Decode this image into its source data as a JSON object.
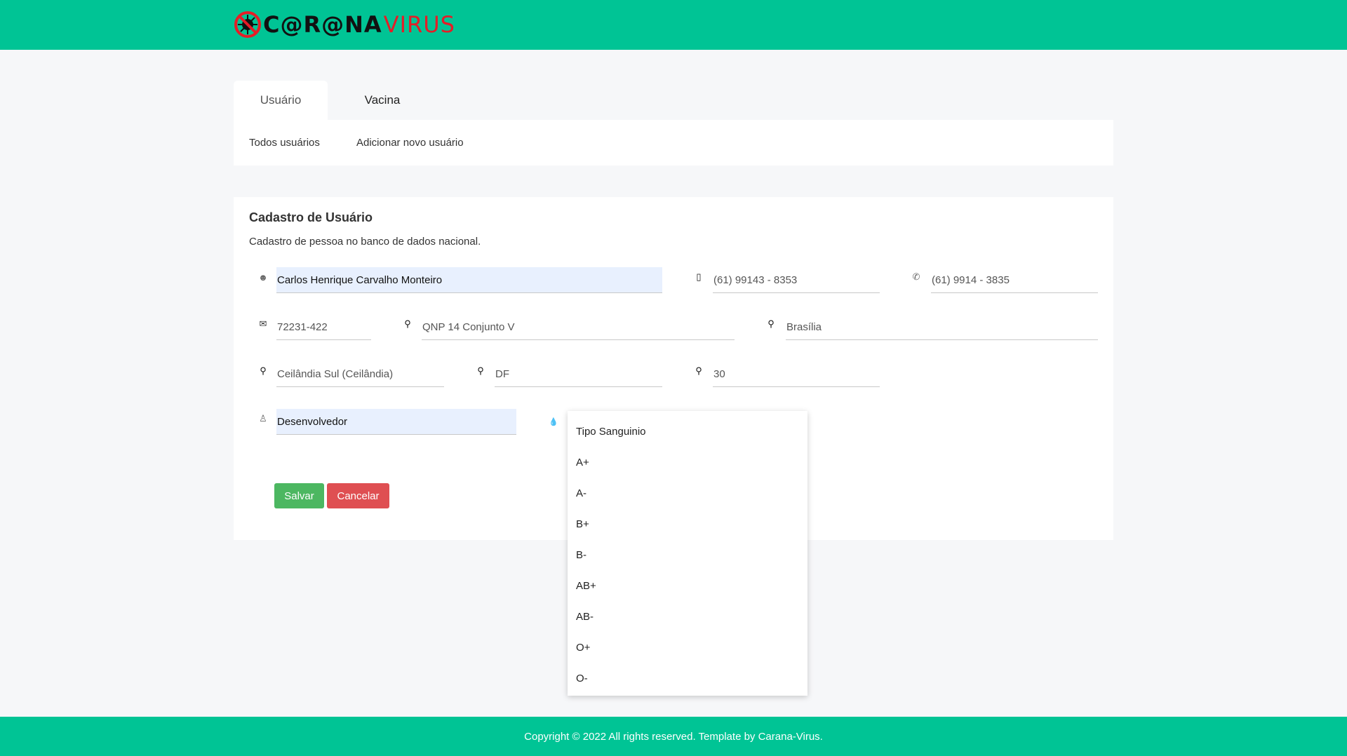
{
  "header": {
    "logo_main": "C@R@NA",
    "logo_accent": "VIRUS",
    "brand_color": "#00c495"
  },
  "tabs": [
    {
      "label": "Usuário",
      "active": true
    },
    {
      "label": "Vacina",
      "active": false
    }
  ],
  "subnav": [
    "Todos usuários",
    "Adicionar novo usuário"
  ],
  "form": {
    "title": "Cadastro de Usuário",
    "subtitle": "Cadastro de pessoa no banco de dados nacional.",
    "fields": {
      "name": "Carlos Henrique Carvalho Monteiro",
      "mobile": "(61) 99143 - 8353",
      "phone": "(61) 9914 - 3835",
      "cep": "72231-422",
      "address": "QNP 14 Conjunto V",
      "city": "Brasília",
      "neighborhood": "Ceilândia Sul (Ceilândia)",
      "state": "DF",
      "number": "30",
      "profession": "Desenvolvedor"
    },
    "save_label": "Salvar",
    "cancel_label": "Cancelar"
  },
  "blood_dropdown": {
    "options": [
      "Tipo Sanguinio",
      "A+",
      "A-",
      "B+",
      "B-",
      "AB+",
      "AB-",
      "O+",
      "O-"
    ]
  },
  "footer": {
    "text": "Copyright © 2022 All rights reserved. Template by Carana-Virus."
  }
}
